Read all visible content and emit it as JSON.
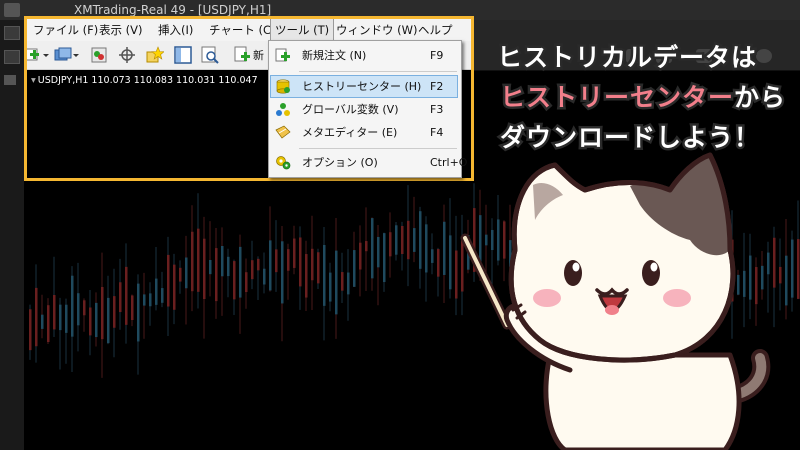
{
  "window": {
    "title": "XMTrading-Real 49 - [USDJPY,H1]"
  },
  "menubar": {
    "items": [
      {
        "label": "ファイル (F)"
      },
      {
        "label": "表示 (V)"
      },
      {
        "label": "挿入(I)"
      },
      {
        "label": "チャート (C)"
      },
      {
        "label": "ツール (T)"
      },
      {
        "label": "ウィンドウ (W)"
      },
      {
        "label": "ヘルプ (H)"
      }
    ]
  },
  "toolbar": {
    "cut_label": "新"
  },
  "chart": {
    "label": "USDJPY,H1  110.073 110.083 110.031 110.047"
  },
  "tools_menu": {
    "items": [
      {
        "label": "新規注文 (N)",
        "shortcut": "F9",
        "icon": "new-order-icon"
      },
      {
        "label": "ヒストリーセンター (H)",
        "shortcut": "F2",
        "icon": "history-center-icon",
        "selected": true
      },
      {
        "label": "グローバル変数 (V)",
        "shortcut": "F3",
        "icon": "global-variables-icon"
      },
      {
        "label": "メタエディター (E)",
        "shortcut": "F4",
        "icon": "meta-editor-icon"
      },
      {
        "label": "オプション (O)",
        "shortcut": "Ctrl+O",
        "icon": "options-icon"
      }
    ]
  },
  "annotation": {
    "line1": "ヒストリカルデータは",
    "line2_highlight": "ヒストリーセンター",
    "line2_rest": "から",
    "line3": "ダウンロードしよう！"
  },
  "colors": {
    "highlight_border": "#f5b731",
    "accent_pink": "#f27f8b",
    "menu_selection": "#cde4f7"
  }
}
